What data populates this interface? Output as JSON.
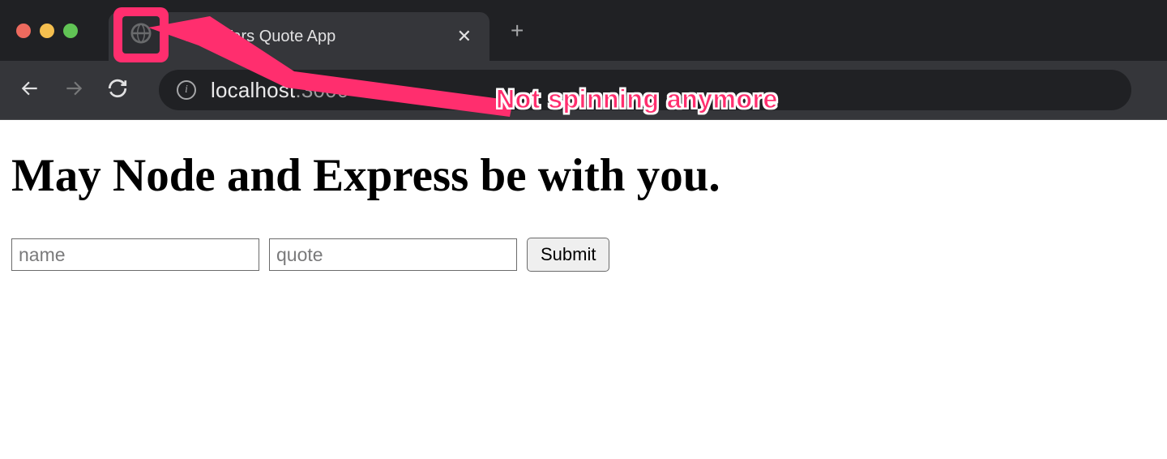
{
  "browser": {
    "tab_title": "Star Wars Quote App",
    "url_host": "localhost",
    "url_port": ":3000"
  },
  "page": {
    "heading": "May Node and Express be with you.",
    "form": {
      "name_placeholder": "name",
      "quote_placeholder": "quote",
      "submit_label": "Submit"
    }
  },
  "annotation": {
    "text": "Not spinning anymore",
    "color": "#ff2e6e"
  }
}
